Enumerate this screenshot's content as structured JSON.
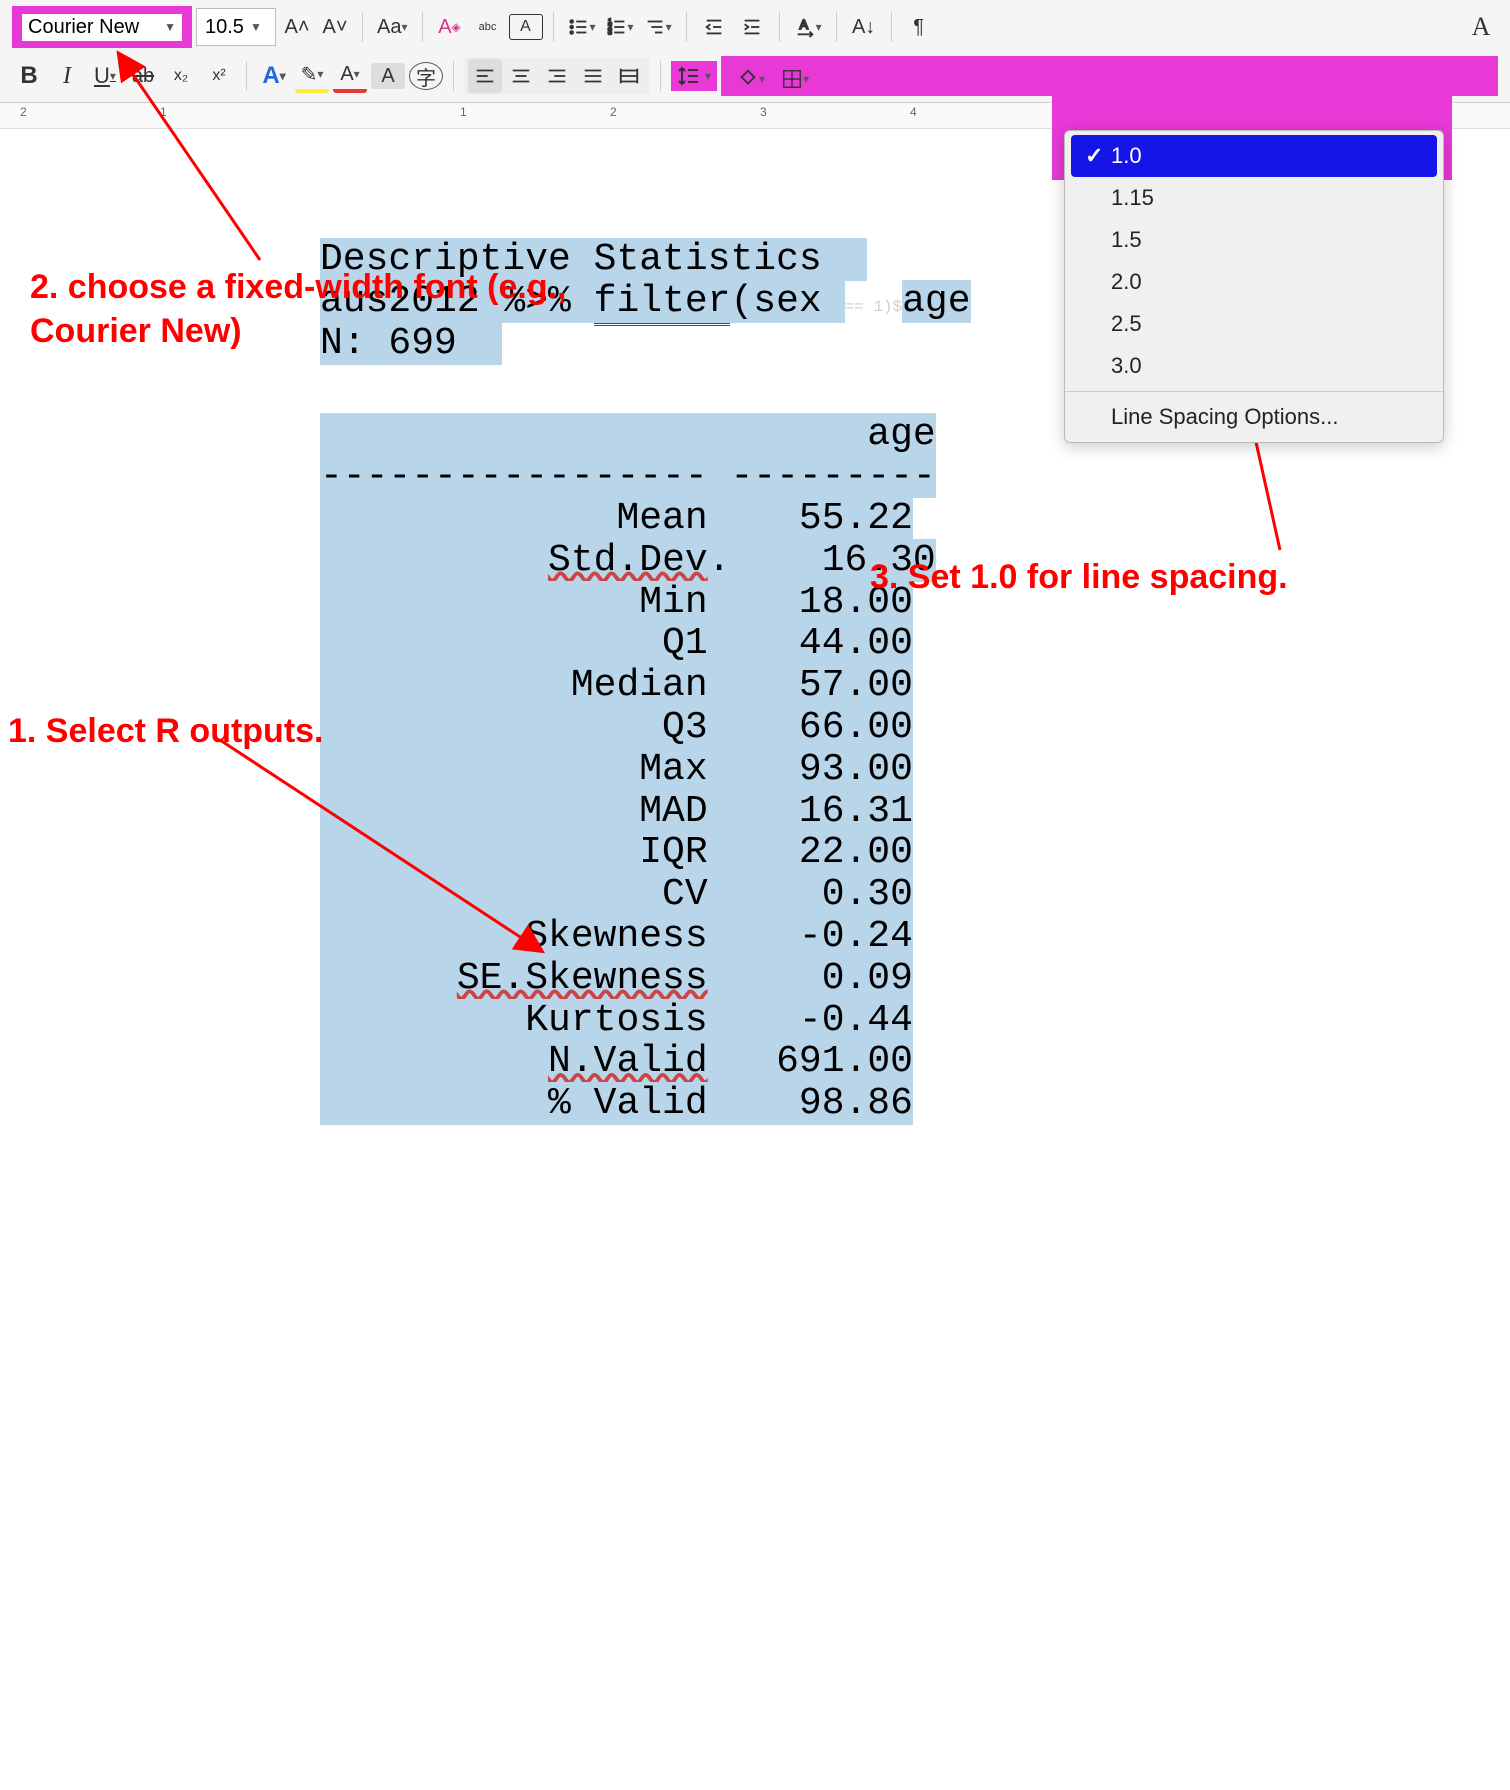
{
  "toolbar": {
    "font_name": "Courier New",
    "font_size": "10.5",
    "bold": "B",
    "italic": "I",
    "underline": "U",
    "strike": "ab",
    "subscript": "x₂",
    "superscript": "x²",
    "grow_font": "A˄",
    "shrink_font": "A˅",
    "case": "Aa",
    "clear_format": "A",
    "char_spacing": "abc",
    "char_box": "A",
    "outline_a": "A",
    "highlight": "✎",
    "font_color": "A",
    "bg_color": "A",
    "char_dialog": "字",
    "pilcrow": "¶",
    "sort": "A↓"
  },
  "line_spacing": {
    "options": [
      "1.0",
      "1.15",
      "1.5",
      "2.0",
      "2.5",
      "3.0"
    ],
    "more": "Line Spacing Options...",
    "selected": "1.0"
  },
  "annotations": {
    "step1": "1. Select R outputs.",
    "step2_line1": "2. choose a fixed-width font  (e.g.,",
    "step2_line2": "Courier New)",
    "step3": "3. Set 1.0 for line spacing."
  },
  "r_output": {
    "title": "Descriptive Statistics  ",
    "subtitle_pre": "aus2012 %>% ",
    "subtitle_filter": "filter",
    "subtitle_mid": "(sex ",
    "subtitle_hidden": "== 1)$",
    "subtitle_end": "age",
    "n_line": "N: 699  ",
    "header": "                        age",
    "divider": "----------------- ---------",
    "rows": [
      {
        "label": "             Mean",
        "value": "    55.22"
      },
      {
        "label": "          Std.Dev",
        "value": "    16.30",
        "wavy": true,
        "dot": "."
      },
      {
        "label": "              Min",
        "value": "    18.00"
      },
      {
        "label": "               Q1",
        "value": "    44.00"
      },
      {
        "label": "           Median",
        "value": "    57.00"
      },
      {
        "label": "               Q3",
        "value": "    66.00"
      },
      {
        "label": "              Max",
        "value": "    93.00"
      },
      {
        "label": "              MAD",
        "value": "    16.31"
      },
      {
        "label": "              IQR",
        "value": "    22.00"
      },
      {
        "label": "               CV",
        "value": "     0.30"
      },
      {
        "label": "         Skewness",
        "value": "    -0.24"
      },
      {
        "label": "      SE.Skewness",
        "value": "     0.09",
        "wavy": true
      },
      {
        "label": "         Kurtosis",
        "value": "    -0.44"
      },
      {
        "label": "          N.Valid",
        "value": "   691.00",
        "wavy": true
      },
      {
        "label": "          % Valid",
        "value": "    98.86"
      }
    ]
  },
  "ruler": {
    "numbers": [
      "2",
      "1",
      "1",
      "2",
      "3",
      "4"
    ]
  },
  "chart_data": {
    "type": "table",
    "title": "Descriptive Statistics",
    "subtitle": "aus2012 %>% filter(sex == 1)$age",
    "n": 699,
    "variable": "age",
    "statistics": [
      {
        "stat": "Mean",
        "value": 55.22
      },
      {
        "stat": "Std.Dev.",
        "value": 16.3
      },
      {
        "stat": "Min",
        "value": 18.0
      },
      {
        "stat": "Q1",
        "value": 44.0
      },
      {
        "stat": "Median",
        "value": 57.0
      },
      {
        "stat": "Q3",
        "value": 66.0
      },
      {
        "stat": "Max",
        "value": 93.0
      },
      {
        "stat": "MAD",
        "value": 16.31
      },
      {
        "stat": "IQR",
        "value": 22.0
      },
      {
        "stat": "CV",
        "value": 0.3
      },
      {
        "stat": "Skewness",
        "value": -0.24
      },
      {
        "stat": "SE.Skewness",
        "value": 0.09
      },
      {
        "stat": "Kurtosis",
        "value": -0.44
      },
      {
        "stat": "N.Valid",
        "value": 691.0
      },
      {
        "stat": "% Valid",
        "value": 98.86
      }
    ]
  }
}
